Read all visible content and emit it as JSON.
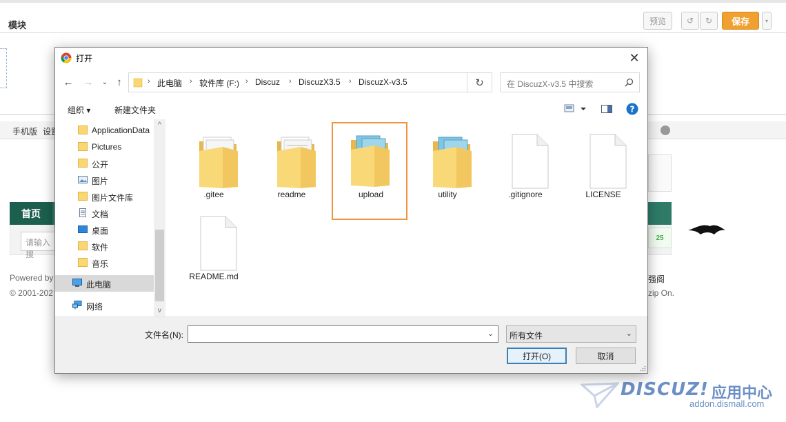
{
  "bg": {
    "title": "模块",
    "preview_label": "预览",
    "save_label": "保存",
    "toolbar_items": [
      "手机版",
      "设置"
    ],
    "nav_home": "首页",
    "search_placeholder": "请输入搜",
    "powered": "Powered by",
    "copyright": "© 2001-202",
    "right_text_1": "强阁",
    "right_text_2": "zip On."
  },
  "watermark": {
    "brand": "DISCUZ!",
    "brand_cn": "应用中心",
    "url": "addon.dismall.com"
  },
  "dialog": {
    "title": "打开",
    "breadcrumb": [
      "此电脑",
      "软件库 (F:)",
      "Discuz",
      "DiscuzX3.5",
      "DiscuzX-v3.5"
    ],
    "search_placeholder": "在 DiscuzX-v3.5 中搜索",
    "organize": "组织 ▾",
    "new_folder": "新建文件夹",
    "tree": [
      {
        "label": "ApplicationData",
        "icon": "folder-icon"
      },
      {
        "label": "Pictures",
        "icon": "folder-icon"
      },
      {
        "label": "公开",
        "icon": "folder-icon"
      },
      {
        "label": "图片",
        "icon": "picture-folder-icon"
      },
      {
        "label": "图片文件库",
        "icon": "folder-icon"
      },
      {
        "label": "文档",
        "icon": "document-folder-icon"
      },
      {
        "label": "桌面",
        "icon": "desktop-folder-icon"
      },
      {
        "label": "软件",
        "icon": "folder-icon"
      },
      {
        "label": "音乐",
        "icon": "folder-icon"
      },
      {
        "label": "此电脑",
        "icon": "computer-icon"
      },
      {
        "label": "网络",
        "icon": "network-icon"
      }
    ],
    "files": [
      {
        "label": ".gitee",
        "type": "folder"
      },
      {
        "label": "readme",
        "type": "folder"
      },
      {
        "label": "upload",
        "type": "folder",
        "selected": true
      },
      {
        "label": "utility",
        "type": "folder"
      },
      {
        "label": ".gitignore",
        "type": "file"
      },
      {
        "label": "LICENSE",
        "type": "file"
      },
      {
        "label": "README.md",
        "type": "file"
      }
    ],
    "filename_label": "文件名(N):",
    "filename_value": "",
    "filetype": "所有文件",
    "open_label": "打开(O)",
    "cancel_label": "取消"
  },
  "colors": {
    "accent": "#f0a030",
    "selection_border": "#f09440",
    "nav_green": "#2f7b68",
    "watermark": "#6c8fc6"
  }
}
